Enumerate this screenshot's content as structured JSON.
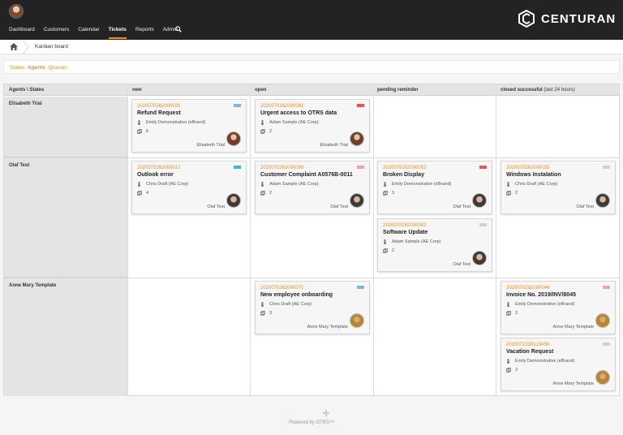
{
  "topbar": {
    "nav": [
      "Dashboard",
      "Customers",
      "Calendar",
      "Tickets",
      "Reports",
      "Admin"
    ],
    "active_index": 3,
    "brand": "CENTURAN",
    "accent": "#f08f1f"
  },
  "breadcrumb": {
    "label": "Kanban board"
  },
  "filters": {
    "states": "States",
    "agents": "Agents",
    "queues": "Queues"
  },
  "board": {
    "corner": "Agents \\ States",
    "columns": [
      {
        "title": "new",
        "note": ""
      },
      {
        "title": "open",
        "note": ""
      },
      {
        "title": "pending reminder",
        "note": ""
      },
      {
        "title": "closed successful",
        "note": "(last 24 hours)"
      }
    ],
    "rows": [
      "Elisabeth Trial",
      "Olaf Test",
      "Anne Mary Template"
    ],
    "cards": [
      {
        "number": "2020070262000026",
        "title": "Refund Request",
        "customer": "Emily Demonstrative (eBrand)",
        "count": "6",
        "owner": "Elisabeth Trial",
        "flag": "#7fb8cf"
      },
      {
        "number": "2020070262000081",
        "title": "Urgent access to OTRS data",
        "customer": "Adam Sample (AE Corp)",
        "count": "2",
        "owner": "Elisabeth Trial",
        "flag": "#e8505b"
      },
      {
        "number": "2020070262000017",
        "title": "Outlook error",
        "customer": "Chris Draft (AE Corp)",
        "count": "4",
        "owner": "Olaf Test",
        "flag": "#3ab4e0"
      },
      {
        "number": "2020070262000099",
        "title": "Customer Complaint A0576B-0011",
        "customer": "Adam Sample (AE Corp)",
        "count": "2",
        "owner": "Olaf Test",
        "flag": "#f0a3a3"
      },
      {
        "number": "2020070262000053",
        "title": "Broken Display",
        "customer": "Emily Demonstrative (eBrand)",
        "count": "3",
        "owner": "Olaf Test",
        "flag": "#e8505b"
      },
      {
        "number": "2020070262000082",
        "title": "Software Update",
        "customer": "Adam Sample (AE Corp)",
        "count": "2",
        "owner": "Olaf Test",
        "flag": "#d0d0d0"
      },
      {
        "number": "2020070262000035",
        "title": "Windows Instalation",
        "customer": "Chris Draft (AE Corp)",
        "count": "2",
        "owner": "Olaf Test",
        "flag": "#d0d0d0"
      },
      {
        "number": "2020070262000071",
        "title": "New employee onboarding",
        "customer": "Chris Draft (AE Corp)",
        "count": "3",
        "owner": "Anne Mary Template",
        "flag": "#7fb8cf"
      },
      {
        "number": "2020070262000044",
        "title": "Invoice No. 2019/INV/8045",
        "customer": "Emily Demonstrative (eBrand)",
        "count": "3",
        "owner": "Anne Mary Template",
        "flag": "#f0a3a3"
      },
      {
        "number": "2015071510123456",
        "title": "Vacation Request",
        "customer": "Emily Demonstrative (eBrand)",
        "count": "3",
        "owner": "Anne Mary Template",
        "flag": "#d0d0d0"
      }
    ]
  },
  "footer": {
    "text": "Powered by OTRS™"
  }
}
